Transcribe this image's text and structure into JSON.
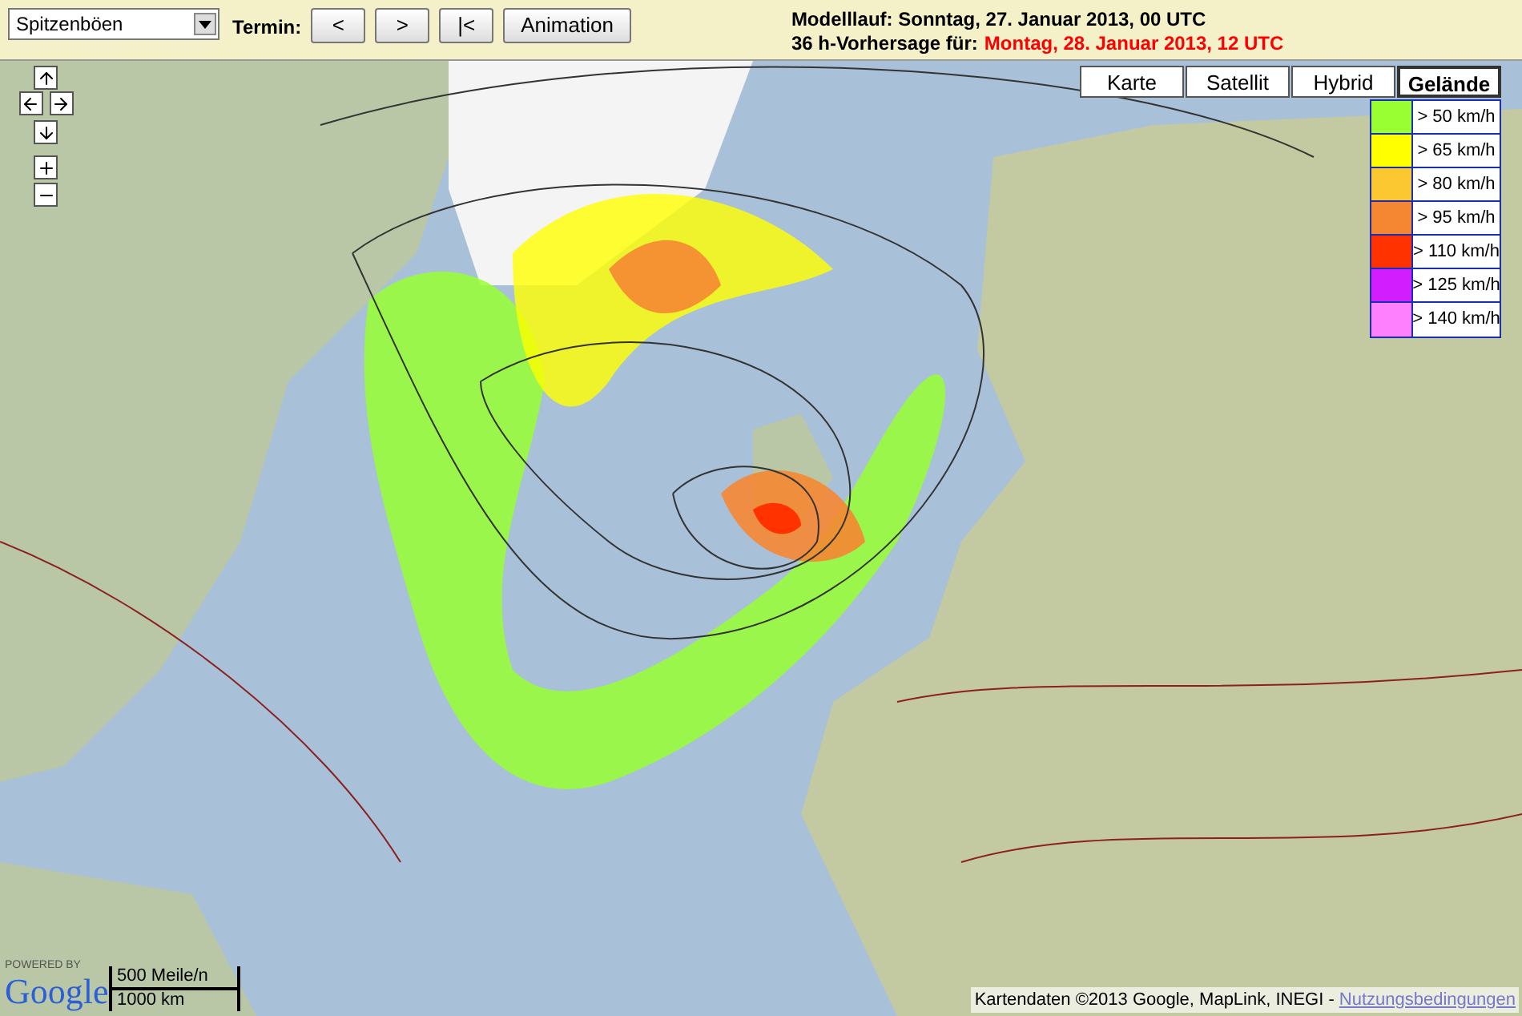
{
  "toolbar": {
    "parameter_select": {
      "value": "Spitzenböen"
    },
    "termin_label": "Termin:",
    "buttons": [
      {
        "label": "<"
      },
      {
        "label": ">"
      },
      {
        "label": "|<"
      },
      {
        "label": "Animation"
      }
    ],
    "run_info": {
      "label": "Modelllauf:",
      "value": "Sonntag, 27. Januar 2013, 00 UTC"
    },
    "forecast_info": {
      "label": "36 h-Vorhersage für:",
      "value": "Montag, 28. Januar 2013, 12 UTC"
    }
  },
  "map_types": [
    {
      "label": "Karte",
      "selected": false
    },
    {
      "label": "Satellit",
      "selected": false
    },
    {
      "label": "Hybrid",
      "selected": false
    },
    {
      "label": "Gelände",
      "selected": true
    }
  ],
  "legend": [
    {
      "label": "> 50 km/h",
      "color": "#99ff33"
    },
    {
      "label": "> 65 km/h",
      "color": "#ffff00"
    },
    {
      "label": "> 80 km/h",
      "color": "#fcc832"
    },
    {
      "label": "> 95 km/h",
      "color": "#f58732"
    },
    {
      "label": "> 110 km/h",
      "color": "#ff3200"
    },
    {
      "label": "> 125 km/h",
      "color": "#d21eff"
    },
    {
      "label": "> 140 km/h",
      "color": "#ff80ff"
    }
  ],
  "branding": {
    "powered_by": "POWERED BY",
    "logo": "Google"
  },
  "scale": {
    "miles": "500 Meile/n",
    "km": "1000 km"
  },
  "attribution": {
    "text": "Kartendaten ©2013 Google, MapLink, INEGI -",
    "link": "Nutzungsbedingungen"
  }
}
